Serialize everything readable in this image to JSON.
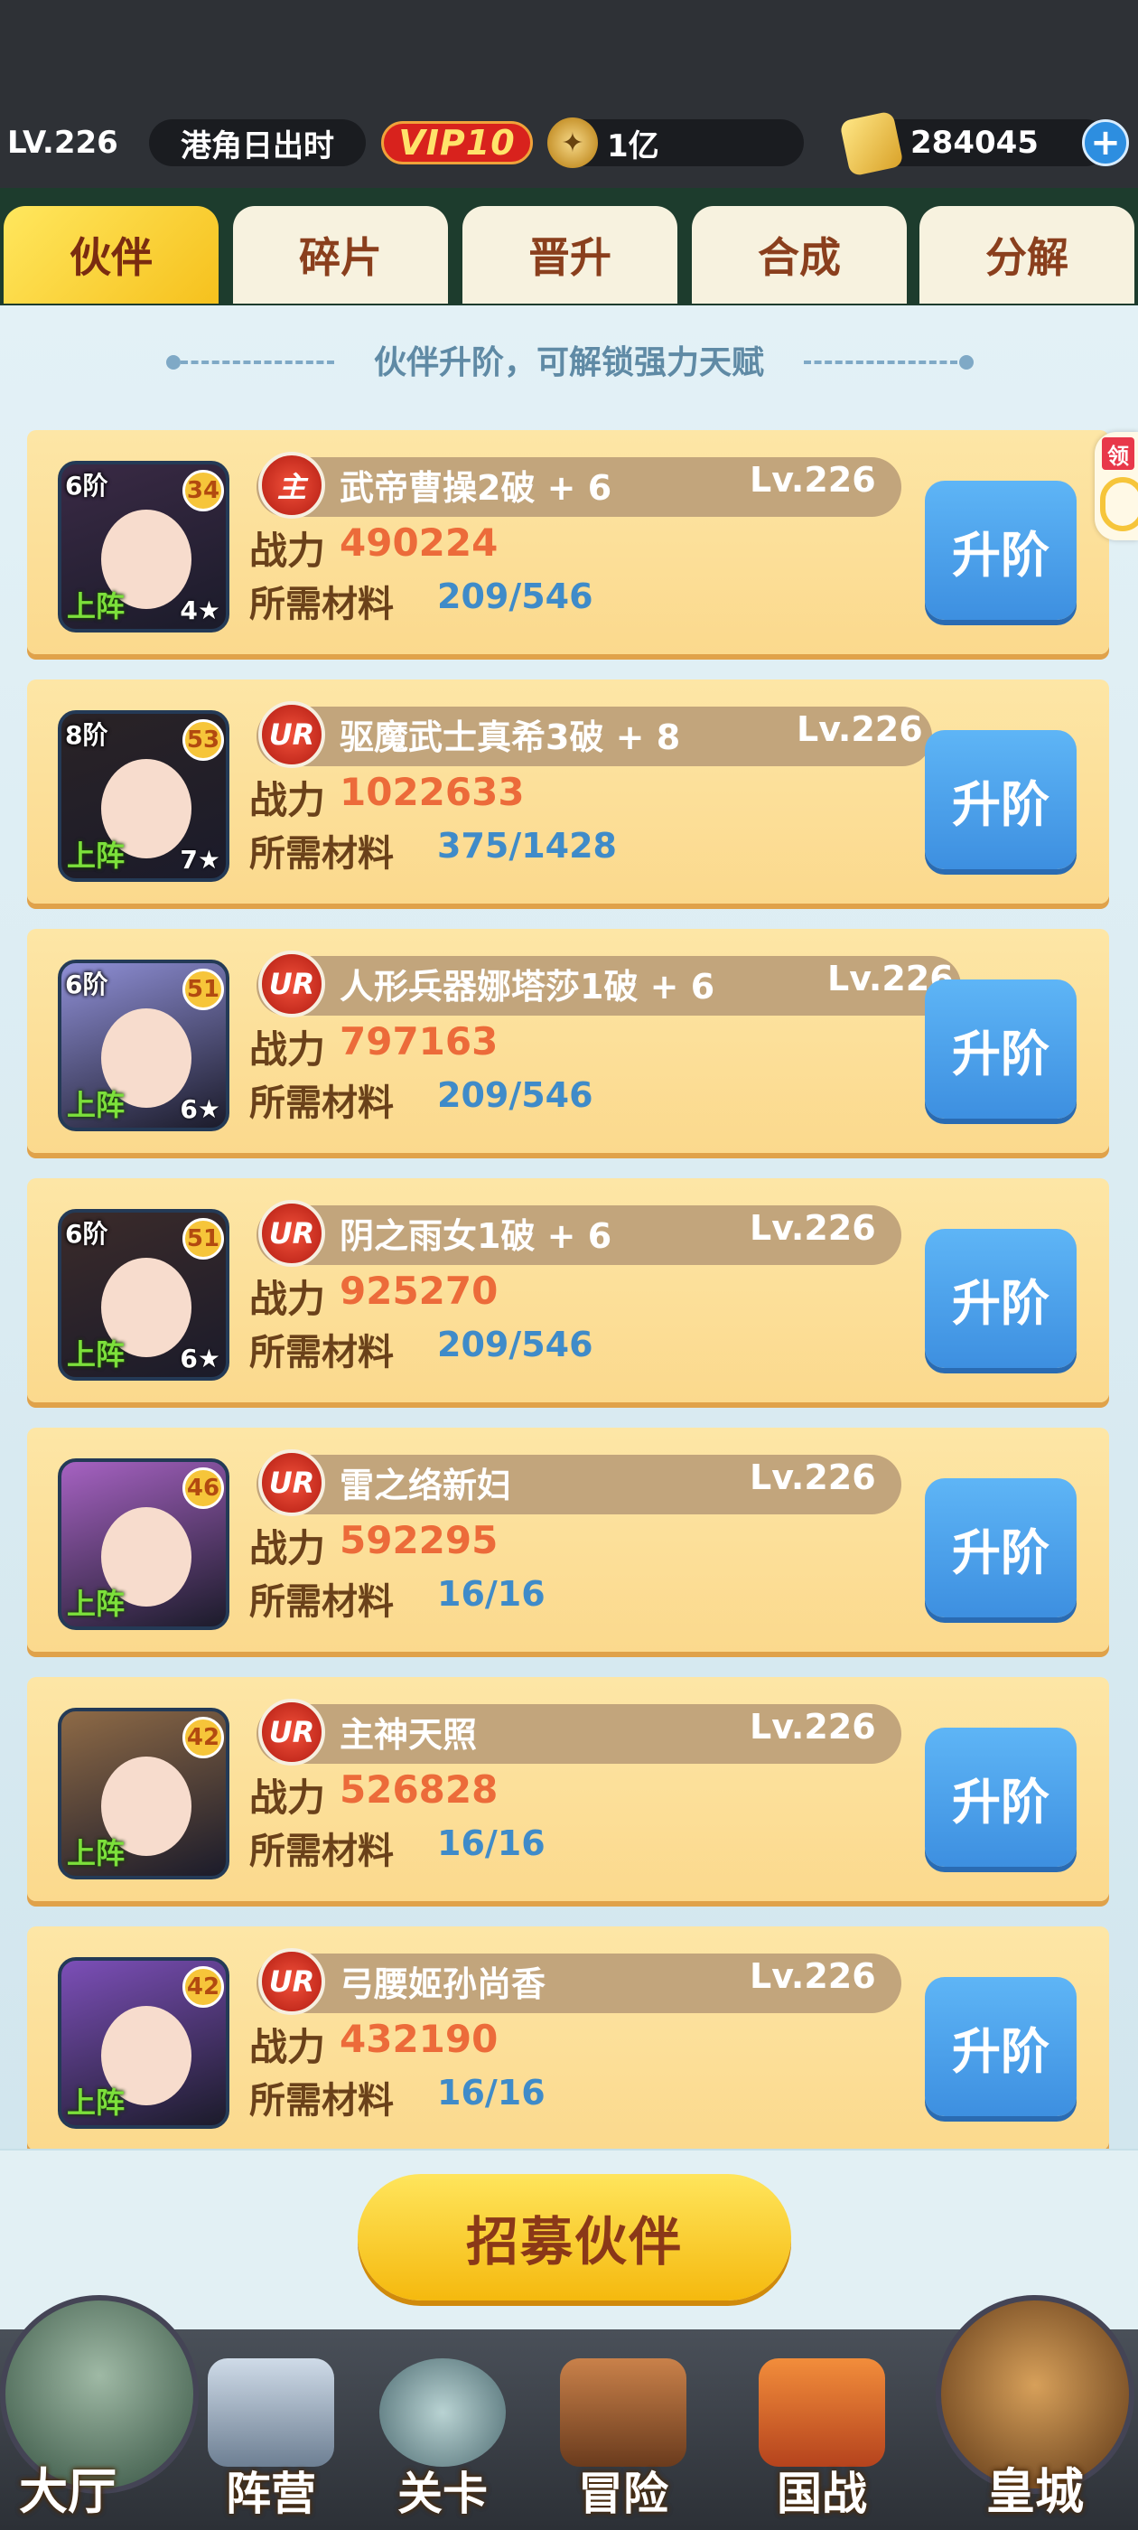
{
  "header": {
    "level": "LV.226",
    "server": "港角日出时",
    "vip": "VIP10",
    "coins": "1亿",
    "coin_icon_glyph": "✦",
    "gold": "284045",
    "plus": "+"
  },
  "tabs": [
    {
      "label": "伙伴"
    },
    {
      "label": "碎片"
    },
    {
      "label": "晋升"
    },
    {
      "label": "合成"
    },
    {
      "label": "分解"
    }
  ],
  "hint": "伙伴升阶，可解锁强力天赋",
  "side_badge": "领",
  "labels": {
    "power": "战力",
    "material": "所需材料",
    "upgrade": "升阶",
    "deploy": "上阵"
  },
  "partners": [
    {
      "stage": "6阶",
      "badge": "34",
      "rarity": "主",
      "name": "武帝曹操2破 + 6",
      "level": "Lv.226",
      "power": "490224",
      "material": "209/546",
      "star": "4★",
      "color": "#3a2a45"
    },
    {
      "stage": "8阶",
      "badge": "53",
      "rarity": "UR",
      "name": "驱魔武士真希3破 + 8",
      "level": "Lv.226",
      "power": "1022633",
      "material": "375/1428",
      "star": "7★",
      "color": "#2a2326"
    },
    {
      "stage": "6阶",
      "badge": "51",
      "rarity": "UR",
      "name": "人形兵器娜塔莎1破 + 6",
      "level": "Lv.226",
      "power": "797163",
      "material": "209/546",
      "star": "6★",
      "color": "#8f8fd6"
    },
    {
      "stage": "6阶",
      "badge": "51",
      "rarity": "UR",
      "name": "阴之雨女1破 + 6",
      "level": "Lv.226",
      "power": "925270",
      "material": "209/546",
      "star": "6★",
      "color": "#3b2b2a"
    },
    {
      "stage": "",
      "badge": "46",
      "rarity": "UR",
      "name": "雷之络新妇",
      "level": "Lv.226",
      "power": "592295",
      "material": "16/16",
      "star": "",
      "color": "#a662c2"
    },
    {
      "stage": "",
      "badge": "42",
      "rarity": "UR",
      "name": "主神天照",
      "level": "Lv.226",
      "power": "526828",
      "material": "16/16",
      "star": "",
      "color": "#8e6a46"
    },
    {
      "stage": "",
      "badge": "42",
      "rarity": "UR",
      "name": "弓腰姬孙尚香",
      "level": "Lv.226",
      "power": "432190",
      "material": "16/16",
      "star": "",
      "color": "#7c4fb8"
    }
  ],
  "recruit_button": "招募伙伴",
  "nav": [
    {
      "label": "大厅",
      "icon": "castle-icon"
    },
    {
      "label": "阵营",
      "icon": "scroll-board-icon"
    },
    {
      "label": "关卡",
      "icon": "crossed-swords-icon"
    },
    {
      "label": "冒险",
      "icon": "ship-icon"
    },
    {
      "label": "国战",
      "icon": "war-banner-icon"
    },
    {
      "label": "皇城",
      "icon": "palace-icon"
    }
  ],
  "colors": {
    "accent_tab": "#f6c11d",
    "upgrade_button": "#3d8fe0",
    "power_value": "#ec6b3a",
    "material_value": "#3f8bc9"
  }
}
